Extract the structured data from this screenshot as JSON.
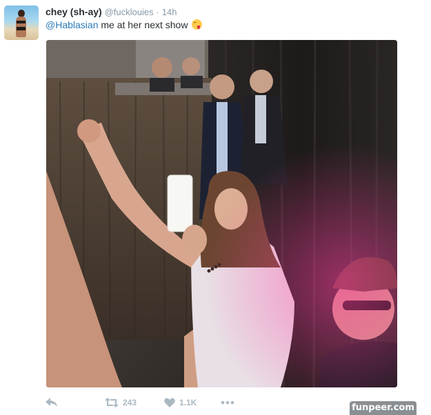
{
  "tweet": {
    "author_name": "chey (sh-ay)",
    "author_handle": "@fucklouies",
    "separator": "·",
    "timestamp": "14h",
    "mention": "@Hablasian",
    "text": " me at her next show",
    "emoji": "face-savoring-food-emoji"
  },
  "actions": {
    "reply_icon": "reply-icon",
    "retweet_icon": "retweet-icon",
    "retweet_count": "243",
    "like_icon": "heart-icon",
    "like_count": "1.1K",
    "more_icon": "more-dots-icon"
  },
  "watermark": "funpeer.com",
  "colors": {
    "link": "#2b7bb9",
    "secondary_text": "#8899a6",
    "action_icons": "#aab8c2",
    "watermark_bg": "#8a8f93"
  }
}
